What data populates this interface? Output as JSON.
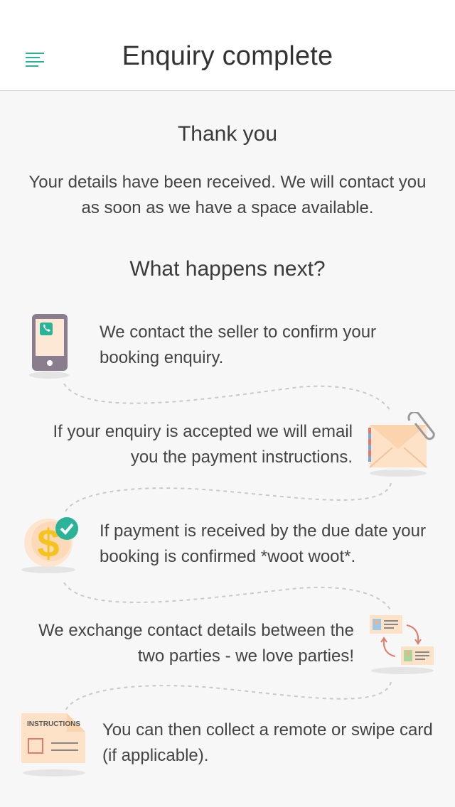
{
  "header": {
    "title": "Enquiry complete",
    "menu_icon": "hamburger-menu-icon",
    "accent_color": "#2bb39a"
  },
  "thanks": {
    "title": "Thank you",
    "message": "Your details have been received. We will contact you as soon as we have a space available."
  },
  "next": {
    "title": "What happens next?",
    "steps": [
      {
        "icon": "phone-icon",
        "text": "We contact the seller to confirm your booking enquiry."
      },
      {
        "icon": "envelope-paperclip-icon",
        "text": "If your enquiry is accepted we will email you the payment instructions."
      },
      {
        "icon": "dollar-check-icon",
        "text": "If payment is received by the due date your booking is confirmed *woot woot*."
      },
      {
        "icon": "contact-exchange-icon",
        "text": "We exchange contact details between the two parties - we love parties!"
      },
      {
        "icon": "instructions-card-icon",
        "text": "You can then collect a remote or swipe card (if applicable)."
      }
    ],
    "instructions_label": "INSTRUCTIONS"
  }
}
